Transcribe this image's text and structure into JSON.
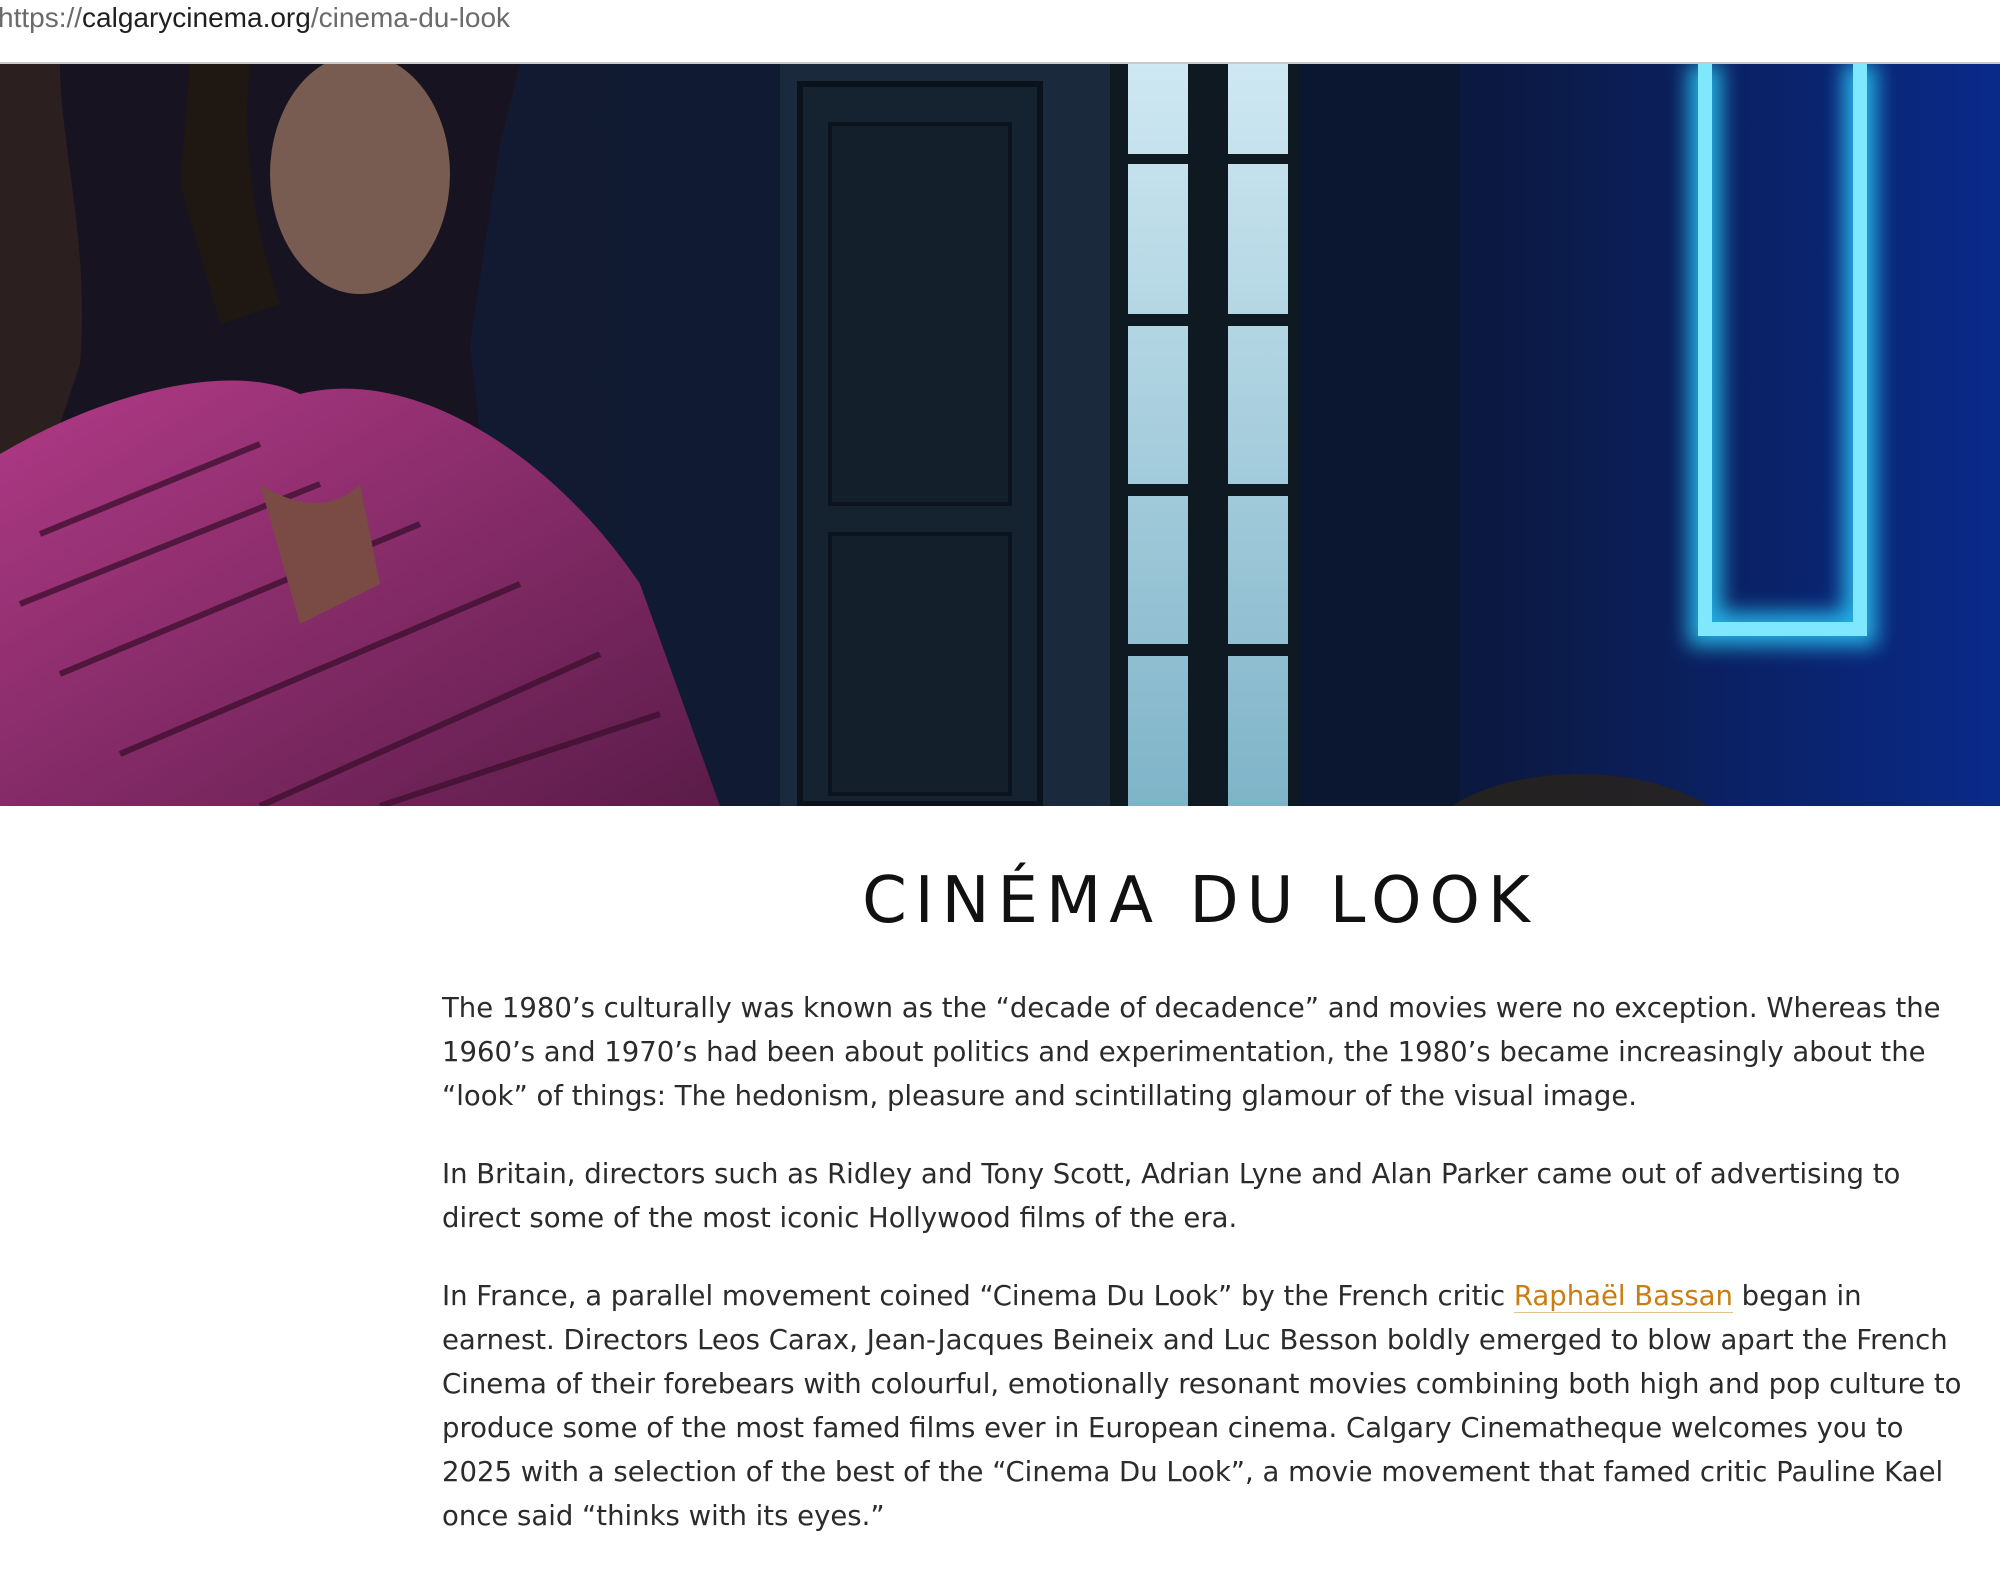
{
  "browser": {
    "url_prefix": "https://",
    "url_host": "calgarycinema.org",
    "url_path": "/cinema-du-look"
  },
  "hero": {
    "image_alt": "",
    "colors": {
      "dark": "#0e1733",
      "neon": "#4fd6ff",
      "dress": "#8a2a64"
    }
  },
  "page": {
    "title": "CINÉMA DU LOOK"
  },
  "article": {
    "p1": "The 1980’s culturally was known as the “decade of decadence” and movies were no exception. Whereas the 1960’s and 1970’s had been about politics and experimentation, the 1980’s became increasingly about the “look” of things: The hedonism, pleasure and scintillating glamour of the visual image.",
    "p2": "In Britain, directors such as Ridley and Tony Scott, Adrian Lyne and Alan Parker came out of advertising to direct some of the most iconic Hollywood films of the era.",
    "p3_before": "In France, a parallel movement coined “Cinema Du Look” by the French critic ",
    "p3_link": "Raphaël Bassan",
    "p3_after": " began in earnest. Directors Leos Carax, Jean-Jacques Beineix and Luc Besson boldly emerged to blow apart the French Cinema of their forebears with colourful, emotionally resonant movies combining both high and pop culture to produce some of the most famed films ever in European cinema. Calgary Cinematheque welcomes you to 2025 with a selection of the best of the “Cinema Du Look”, a movie movement that famed critic Pauline Kael once said “thinks with its eyes.”"
  },
  "link_color": "#c97d12"
}
